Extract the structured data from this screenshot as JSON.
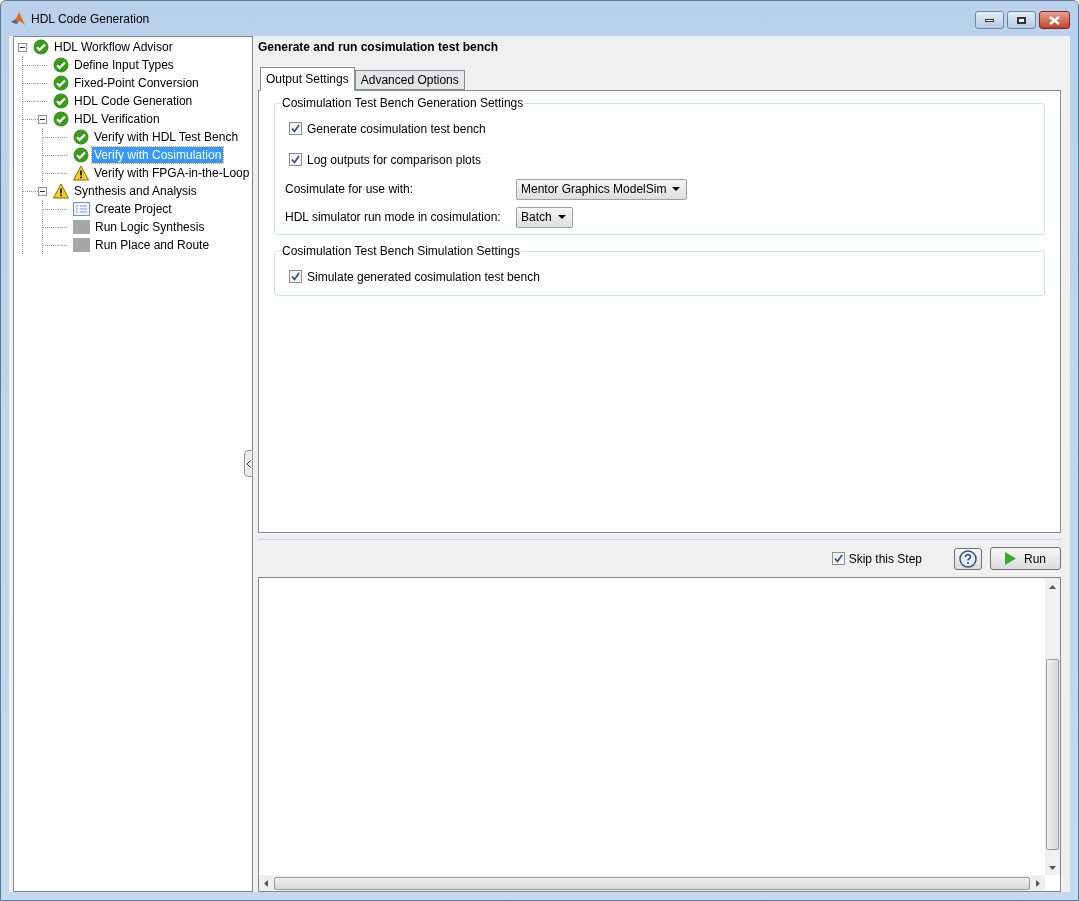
{
  "window": {
    "title": "HDL Code Generation"
  },
  "tree": [
    {
      "label": "HDL Workflow Advisor",
      "kind": "pass",
      "expanded": true,
      "selected": false,
      "children": [
        {
          "label": "Define Input Types",
          "kind": "pass",
          "selected": false
        },
        {
          "label": "Fixed-Point Conversion",
          "kind": "pass",
          "selected": false
        },
        {
          "label": "HDL Code Generation",
          "kind": "pass",
          "selected": false
        },
        {
          "label": "HDL Verification",
          "kind": "pass",
          "expanded": true,
          "selected": false,
          "children": [
            {
              "label": "Verify with HDL Test Bench",
              "kind": "pass",
              "selected": false
            },
            {
              "label": "Verify with Cosimulation",
              "kind": "pass",
              "selected": true
            },
            {
              "label": "Verify with FPGA-in-the-Loop",
              "kind": "warning",
              "selected": false
            }
          ]
        },
        {
          "label": "Synthesis and Analysis",
          "kind": "warning",
          "expanded": true,
          "selected": false,
          "children": [
            {
              "label": "Create Project",
              "kind": "task",
              "selected": false
            },
            {
              "label": "Run Logic Synthesis",
              "kind": "pending",
              "selected": false
            },
            {
              "label": "Run Place and Route",
              "kind": "pending",
              "selected": false
            }
          ]
        }
      ]
    }
  ],
  "task_title": "Generate and run cosimulation test bench",
  "tabs": [
    {
      "label": "Output Settings",
      "selected": true
    },
    {
      "label": "Advanced Options",
      "selected": false
    }
  ],
  "groups": [
    {
      "title": "Cosimulation Test Bench Generation Settings",
      "items": [
        {
          "kind": "checkbox",
          "label": "Generate cosimulation test bench",
          "checked": true
        },
        {
          "kind": "checkbox",
          "label": "Log outputs for comparison plots",
          "checked": true
        },
        {
          "kind": "dropdown",
          "label": "Cosimulate for use with:",
          "value": "Mentor Graphics ModelSim"
        },
        {
          "kind": "dropdown",
          "label": "HDL simulator run mode in cosimulation:",
          "value": "Batch"
        }
      ]
    },
    {
      "title": "Cosimulation Test Bench Simulation Settings",
      "items": [
        {
          "kind": "checkbox",
          "label": "Simulate generated cosimulation test bench",
          "checked": true
        }
      ]
    }
  ],
  "skip_step": {
    "label": "Skip this Step",
    "checked": true
  },
  "run_button": {
    "label": "Run"
  }
}
